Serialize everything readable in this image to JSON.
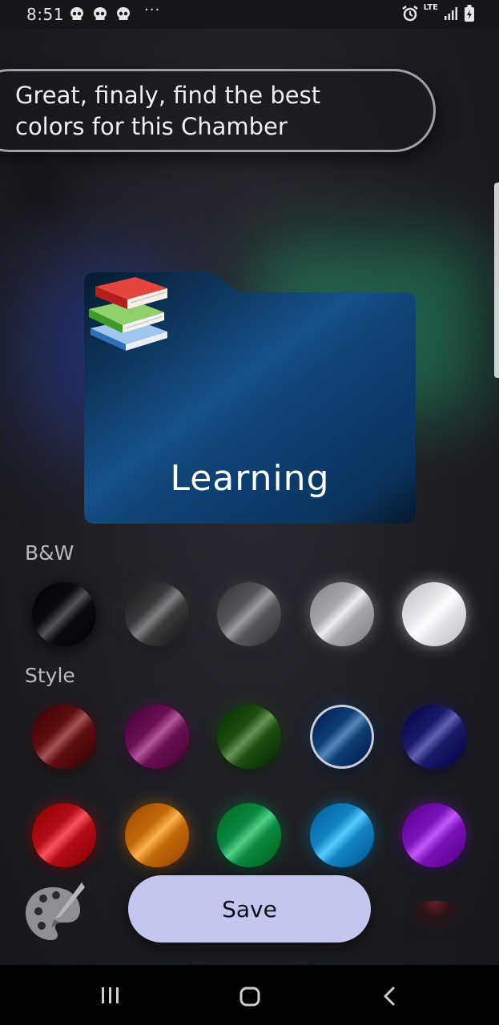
{
  "status_bar": {
    "time": "8:51",
    "notification_icons": [
      "skull-icon",
      "skull-icon",
      "skull-icon"
    ],
    "more": "···",
    "network": "LTE",
    "right_icons": [
      "alarm-icon",
      "lte-icon",
      "signal-icon",
      "battery-charging-icon"
    ]
  },
  "prompt": {
    "text": "Great, finaly, find the best colors for this Chamber"
  },
  "folder": {
    "emoji": "books-icon",
    "label": "Learning",
    "selected_color": "#0e3f74"
  },
  "sections": {
    "bw": {
      "label": "B&W",
      "swatches": [
        {
          "name": "black",
          "color": "#0b0b10"
        },
        {
          "name": "dark-gray",
          "color": "#3a3a3d"
        },
        {
          "name": "gray",
          "color": "#55575c"
        },
        {
          "name": "silver",
          "color": "#a7a8ac"
        },
        {
          "name": "white",
          "color": "#e4e6ea"
        }
      ]
    },
    "style": {
      "label": "Style",
      "row1": [
        {
          "name": "dark-red",
          "color": "#5e0d10"
        },
        {
          "name": "dark-magenta",
          "color": "#6c0f55"
        },
        {
          "name": "dark-green",
          "color": "#1e4f0f"
        },
        {
          "name": "navy",
          "color": "#0e3f74",
          "selected": true
        },
        {
          "name": "indigo",
          "color": "#1b1a6a"
        }
      ],
      "row2": [
        {
          "name": "red",
          "color": "#b20d14"
        },
        {
          "name": "orange",
          "color": "#c26b0c"
        },
        {
          "name": "green",
          "color": "#0a8a43"
        },
        {
          "name": "sky-blue",
          "color": "#1283c0"
        },
        {
          "name": "purple",
          "color": "#7b12b5"
        }
      ]
    }
  },
  "actions": {
    "palette_icon": "palette-icon",
    "save_label": "Save"
  },
  "nav": {
    "icons": [
      "recent-apps-icon",
      "home-icon",
      "back-icon"
    ]
  }
}
